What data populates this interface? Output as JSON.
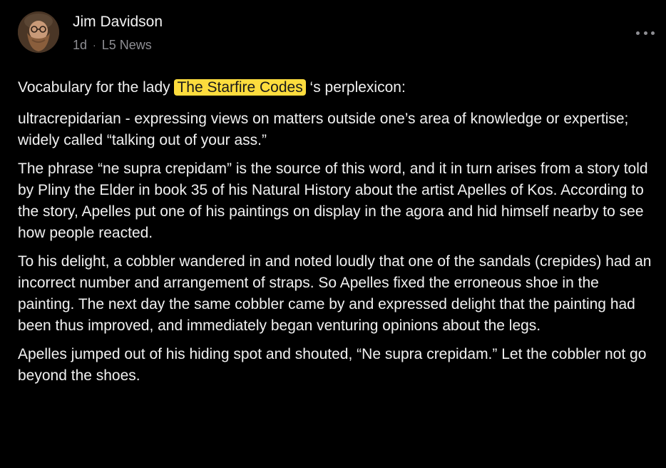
{
  "author": {
    "name": "Jim Davidson",
    "avatar_icon": "user-avatar-photo"
  },
  "meta": {
    "age": "1d",
    "separator": "·",
    "community": "L5 News"
  },
  "more_button": {
    "icon": "more-horizontal-icon"
  },
  "post": {
    "intro_before": "Vocabulary for the lady ",
    "mention": "The Starfire Codes",
    "intro_after": " ‘s perplexicon:",
    "paragraphs": [
      "ultracrepidarian - expressing views on matters outside one’s area of knowledge or expertise; widely called “talking out of your ass.”",
      "The phrase “ne supra crepidam” is the source of this word, and it in turn arises from a story told by Pliny the Elder in book 35 of his Natural History about the artist Apelles of Kos. According to the story, Apelles put one of his paintings on display in the agora and hid himself nearby to see how people reacted.",
      "To his delight, a cobbler wandered in and noted loudly that one of the sandals (crepides) had an incorrect number and arrangement of straps. So Apelles fixed the erroneous shoe in the painting. The next day the same cobbler came by and expressed delight that the painting had been thus improved, and immediately began venturing opinions about the legs.",
      "Apelles jumped out of his hiding spot and shouted, “Ne supra crepidam.” Let the cobbler not go beyond the shoes."
    ]
  },
  "colors": {
    "background": "#000000",
    "text": "#f1f1f1",
    "muted": "#8e8e93",
    "mention_highlight": "#fddc3d"
  }
}
